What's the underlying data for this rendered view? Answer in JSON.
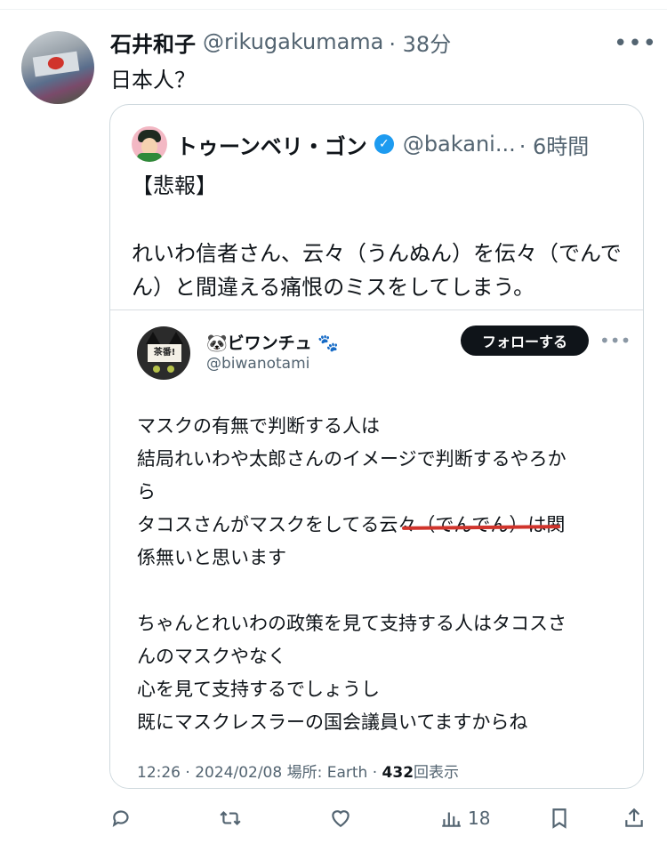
{
  "tweet": {
    "name": "石井和子",
    "handle": "@rikugakumama",
    "time": "· 38分",
    "text": "日本人？",
    "more": "•••"
  },
  "quote": {
    "name": "トゥーンベリ・ゴン",
    "verified": "✓",
    "handle": "@bakani...",
    "time": "· 6時間",
    "text": "【悲報】\n\nれいわ信者さん、云々（うんぬん）を伝々（でんでん）と間違える痛恨のミスをしてしまう。"
  },
  "screenshot": {
    "avatar_text": "茶番!",
    "name": "🐼ビワンチュ 🐾",
    "handle": "@biwanotami",
    "follow_label": "フォローする",
    "more": "•••",
    "text": "マスクの有無で判断する人は\n結局れいわや太郎さんのイメージで判断するやろか\nら\nタコスさんがマスクをしてる云々（でんでん）は関\n係無いと思います\n\nちゃんとれいわの政策を見て支持する人はタコスさ\nんのマスクやなく\n心を見て支持するでしょうし\n既にマスクレスラーの国会議員いてますからね",
    "meta_prefix": "12:26 · 2024/02/08 場所: Earth · ",
    "views_count": "432",
    "views_label": "回表示",
    "underline_color": "#d0342c"
  },
  "actions": {
    "reply_icon": "reply-icon",
    "retweet_icon": "retweet-icon",
    "like_icon": "heart-icon",
    "views_icon": "views-icon",
    "views_count": "18",
    "bookmark_icon": "bookmark-icon",
    "share_icon": "share-icon"
  },
  "colors": {
    "accent": "#1d9bf0",
    "muted": "#536471"
  }
}
